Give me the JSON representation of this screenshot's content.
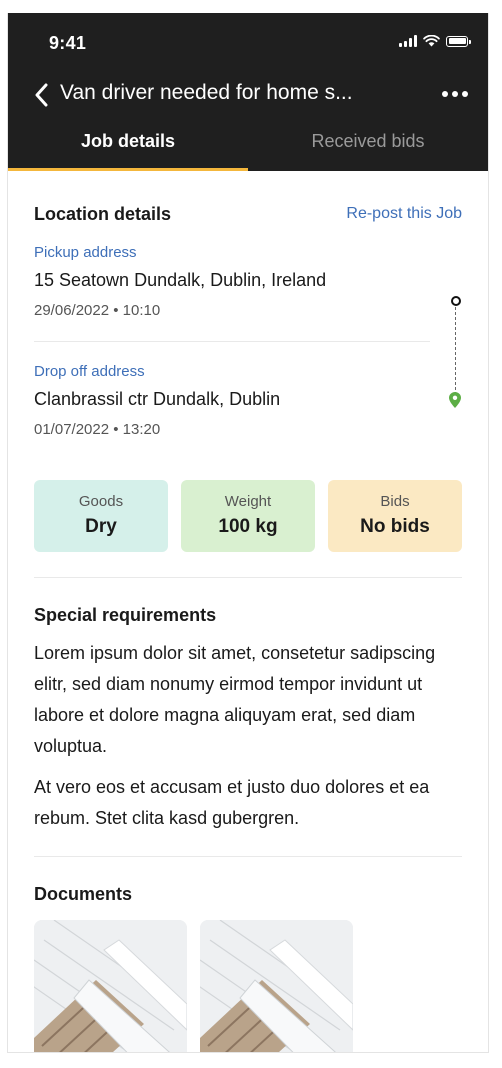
{
  "status_bar": {
    "time": "9:41"
  },
  "header": {
    "title": "Van driver needed for home s...",
    "tabs": [
      {
        "label": "Job details",
        "active": true
      },
      {
        "label": "Received bids",
        "active": false
      }
    ]
  },
  "location": {
    "heading": "Location details",
    "repost_label": "Re-post this Job",
    "pickup": {
      "label": "Pickup address",
      "address": "15 Seatown Dundalk, Dublin, Ireland",
      "datetime": "29/06/2022 • 10:10"
    },
    "dropoff": {
      "label": "Drop off address",
      "address": "Clanbrassil ctr Dundalk, Dublin",
      "datetime": "01/07/2022 • 13:20"
    }
  },
  "chips": [
    {
      "label": "Goods",
      "value": "Dry",
      "color": "#d5f0ea"
    },
    {
      "label": "Weight",
      "value": "100 kg",
      "color": "#d9f0d0"
    },
    {
      "label": "Bids",
      "value": "No bids",
      "color": "#fbe9c3"
    }
  ],
  "special": {
    "heading": "Special requirements",
    "paragraphs": [
      "Lorem ipsum dolor sit amet, consetetur sadipscing elitr, sed diam nonumy eirmod tempor invidunt ut labore et dolore magna aliquyam erat, sed diam voluptua.",
      "At vero eos et accusam et justo duo dolores et ea rebum. Stet clita kasd gubergren."
    ]
  },
  "documents": {
    "heading": "Documents"
  },
  "colors": {
    "accent": "#f4b73c",
    "link": "#3e6fb8",
    "header_bg": "#1f1f1f",
    "pin": "#5cae45"
  }
}
